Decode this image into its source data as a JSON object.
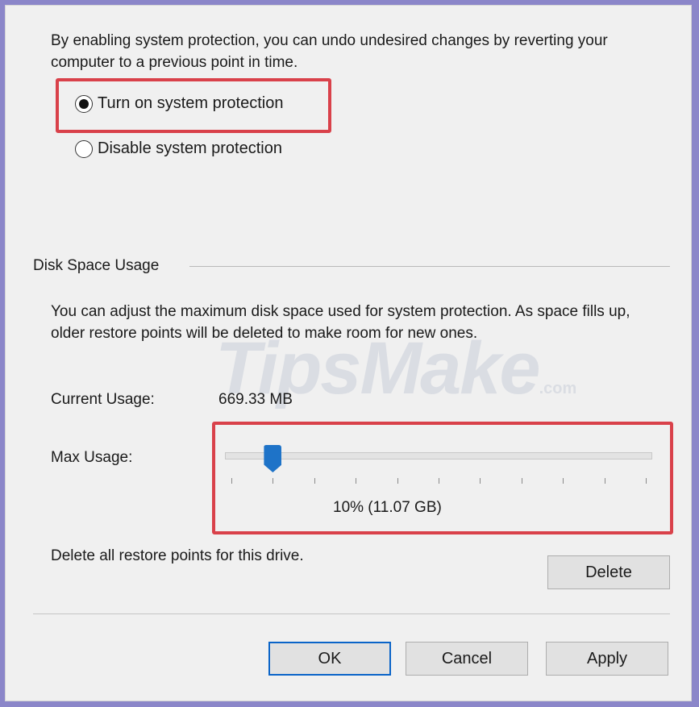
{
  "dialog": {
    "intro_text": "By enabling system protection, you can undo undesired changes by reverting your computer to a previous point in time.",
    "radio_options": [
      {
        "label": "Turn on system protection",
        "selected": true
      },
      {
        "label": "Disable system protection",
        "selected": false
      }
    ],
    "disk_space": {
      "group_label": "Disk Space Usage",
      "description": "You can adjust the maximum disk space used for system protection. As space fills up, older restore points will be deleted to make room for new ones.",
      "current_usage_label": "Current Usage:",
      "current_usage_value": "669.33 MB",
      "max_usage_label": "Max Usage:",
      "slider_percent": 10,
      "slider_value_text": "10% (11.07 GB)"
    },
    "delete_text": "Delete all restore points for this drive.",
    "buttons": {
      "delete": "Delete",
      "ok": "OK",
      "cancel": "Cancel",
      "apply": "Apply"
    }
  },
  "watermark": {
    "text": "TipsMake",
    "suffix": ".com"
  },
  "colors": {
    "highlight": "#d9414a",
    "slider_thumb": "#1e73c8",
    "dialog_bg": "#f0f0f0",
    "page_border": "#8b86c9"
  }
}
